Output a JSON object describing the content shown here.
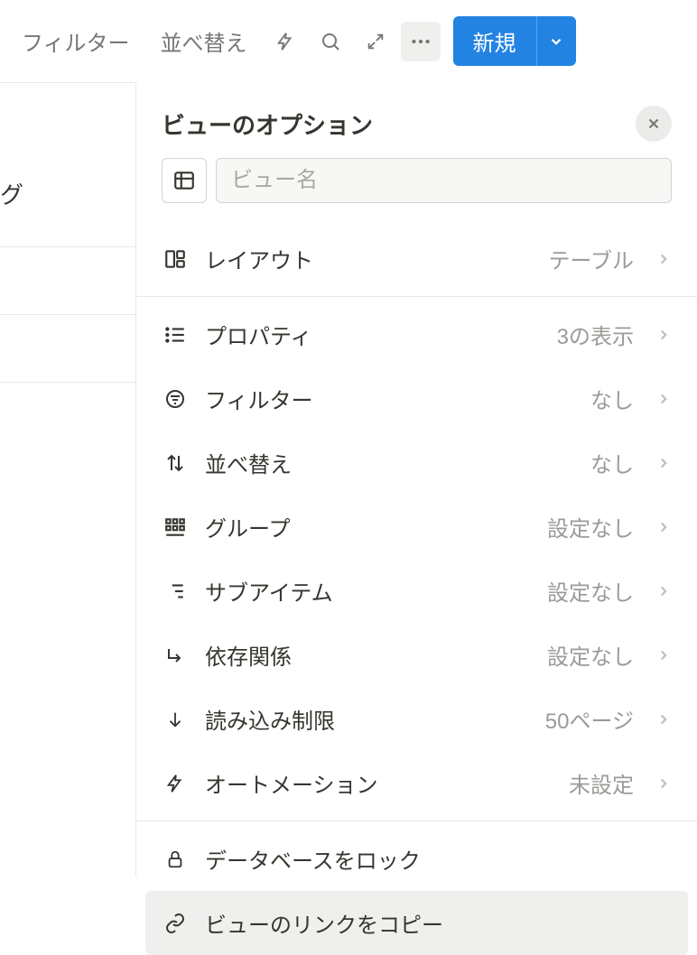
{
  "toolbar": {
    "filter": "フィルター",
    "sort": "並べ替え",
    "new": "新規"
  },
  "left": {
    "fragment1": "グ"
  },
  "panel": {
    "title": "ビューのオプション",
    "view_name_placeholder": "ビュー名",
    "layout": {
      "label": "レイアウト",
      "value": "テーブル"
    },
    "properties": {
      "label": "プロパティ",
      "value": "3の表示"
    },
    "filter": {
      "label": "フィルター",
      "value": "なし"
    },
    "sort": {
      "label": "並べ替え",
      "value": "なし"
    },
    "group": {
      "label": "グループ",
      "value": "設定なし"
    },
    "subitems": {
      "label": "サブアイテム",
      "value": "設定なし"
    },
    "dependencies": {
      "label": "依存関係",
      "value": "設定なし"
    },
    "load_limit": {
      "label": "読み込み制限",
      "value": "50ページ"
    },
    "automation": {
      "label": "オートメーション",
      "value": "未設定"
    },
    "lock_db": {
      "label": "データベースをロック"
    },
    "copy_link": {
      "label": "ビューのリンクをコピー"
    }
  }
}
